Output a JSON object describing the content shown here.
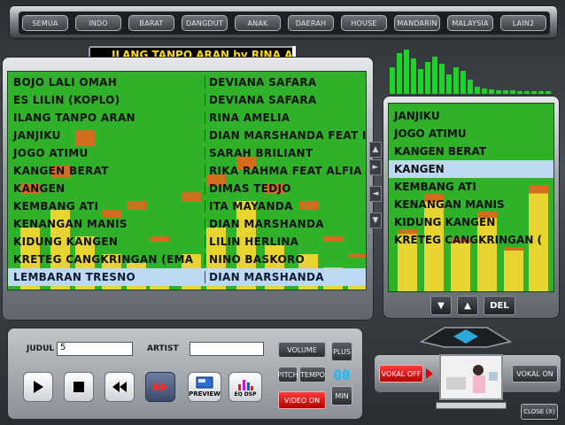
{
  "categories": [
    "SEMUA",
    "INDO",
    "BARAT",
    "DANGDUT",
    "ANAK",
    "DAERAH",
    "HOUSE",
    "MANDARIN",
    "MALAYSIA",
    "LAIN2"
  ],
  "marquee": "ILANG TANPO ARAN by RINA A",
  "main_list": {
    "rows": [
      {
        "title": "BOJO LALI OMAH",
        "artist": "DEVIANA SAFARA"
      },
      {
        "title": "ES LILIN (KOPLO)",
        "artist": "DEVIANA SAFARA"
      },
      {
        "title": "ILANG TANPO ARAN",
        "artist": "RINA AMELIA"
      },
      {
        "title": "JANJIKU",
        "artist": "DIAN MARSHANDA FEAT I"
      },
      {
        "title": "JOGO ATIMU",
        "artist": "SARAH BRILIANT"
      },
      {
        "title": "KANGEN BERAT",
        "artist": "RIKA RAHMA FEAT ALFIA"
      },
      {
        "title": "KANGEN",
        "artist": "DIMAS TEDJO"
      },
      {
        "title": "KEMBANG ATI",
        "artist": "ITA MAYANDA"
      },
      {
        "title": "KENANGAN MANIS",
        "artist": "DIAN MARSHANDA"
      },
      {
        "title": "KIDUNG KANGEN",
        "artist": "LILIN HERLINA"
      },
      {
        "title": "KRETEG CANGKRINGAN (EMA",
        "artist": "NINO BASKORO"
      },
      {
        "title": "LEMBARAN TRESNO",
        "artist": "DIAN MARSHANDA"
      }
    ],
    "selected_index": 11
  },
  "right_list": {
    "rows": [
      "JANJIKU",
      "JOGO ATIMU",
      "KANGEN BERAT",
      "KANGEN",
      "KEMBANG ATI",
      "KENANGAN MANIS",
      "KIDUNG KANGEN",
      "KRETEG CANGKRINGAN ("
    ],
    "selected_index": 3,
    "del_label": "DEL",
    "down_label": "▼",
    "up_label": "▲"
  },
  "controls": {
    "judul_label": "JUDUL",
    "judul_value": "5",
    "artist_label": "ARTIST",
    "artist_value": "",
    "volume_label": "VOLUME",
    "plus_label": "PLUS",
    "min_label": "MIN",
    "pitch_label": "PITCH",
    "tempo_label": "TEMPO",
    "video_on_label": "VIDEO ON",
    "counter": "00",
    "preview_label": "PREVIEW",
    "eq_label": "EQ DSP"
  },
  "vocal": {
    "off_label": "VOKAL OFF",
    "on_label": "VOKAL ON"
  },
  "close_label": "CLOSE (X)",
  "colors": {
    "list_green": "#2fb12a",
    "selection": "#bcd8f3",
    "marquee_text": "#ffde00",
    "counter_blue": "#1cb8ff",
    "red_button": "#e00000"
  }
}
